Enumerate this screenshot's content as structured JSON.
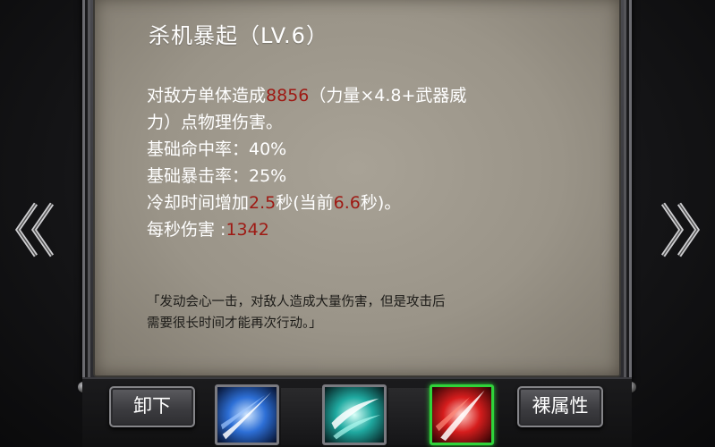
{
  "skill": {
    "title": "杀机暴起（LV.6）",
    "desc_line1": {
      "prefix": "对敌方单体造成",
      "value": "8856",
      "suffix": "（力量×4.8+武器威"
    },
    "desc_line2": "力）点物理伤害。",
    "hit_rate": "基础命中率：40%",
    "crit_rate": "基础暴击率：25%",
    "cooldown": {
      "prefix": "冷却时间增加",
      "added": "2.5",
      "mid": "秒(当前",
      "current": "6.6",
      "suffix": "秒)。"
    },
    "dps": {
      "label": "每秒伤害 :",
      "value": "1342"
    },
    "quote_line1": "「发动会心一击，对敌人造成大量伤害，但是攻击后",
    "quote_line2": "需要很长时间才能再次行动。」"
  },
  "buttons": {
    "unequip": "卸下",
    "naked_stats": "裸属性"
  },
  "skill_slots": [
    {
      "icon": "blue-slash-icon",
      "selected": false
    },
    {
      "icon": "cyan-wind-slash-icon",
      "selected": false
    },
    {
      "icon": "red-slash-icon",
      "selected": true
    }
  ],
  "navigation": {
    "prev_icon": "double-chevron-left-icon",
    "next_icon": "double-chevron-right-icon"
  },
  "colors": {
    "highlight_value": "#9e1a14",
    "panel": "#9a9488",
    "selected_border": "#2fd33a"
  }
}
